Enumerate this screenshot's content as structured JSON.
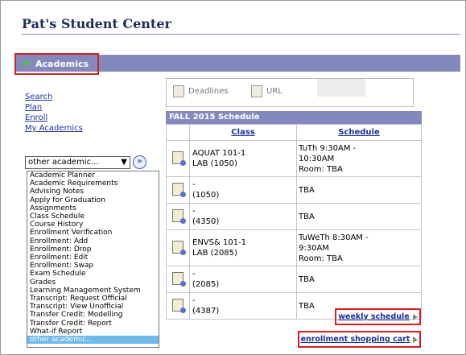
{
  "page_title": "Pat's Student Center",
  "section": {
    "label": "Academics"
  },
  "links": [
    "Search",
    "Plan",
    "Enroll",
    "My Academics"
  ],
  "dropdown": {
    "selected": "other academic...",
    "go_icon": "double-chevron-right-icon"
  },
  "listbox_items": [
    "Academic Planner",
    "Academic Requirements",
    "Advising Notes",
    "Apply for Graduation",
    "Assignments",
    "Class Schedule",
    "Course History",
    "Enrollment Verification",
    "Enrollment: Add",
    "Enrollment: Drop",
    "Enrollment: Edit",
    "Enrollment: Swap",
    "Exam Schedule",
    "Grades",
    "Learning Management System",
    "Transcript: Request Official",
    "Transcript: View Unofficial",
    "Transfer Credit: Modelling",
    "Transfer Credit: Report",
    "What-if Report",
    "other academic..."
  ],
  "listbox_selected": "other academic...",
  "deadlines": {
    "deadlines_label": "Deadlines",
    "url_label": "URL"
  },
  "schedule": {
    "header": "FALL 2015 Schedule",
    "col_class": "Class",
    "col_schedule": "Schedule",
    "rows": [
      {
        "class_line1": "AQUAT 101-1",
        "class_line2": "LAB (1050)",
        "sch1": "TuTh 9:30AM -",
        "sch2": "10:30AM",
        "sch3": "Room:  TBA"
      },
      {
        "class_line1": "-",
        "class_line2": "(1050)",
        "sch1": "TBA",
        "sch2": "",
        "sch3": ""
      },
      {
        "class_line1": "-",
        "class_line2": "(4350)",
        "sch1": "TBA",
        "sch2": "",
        "sch3": ""
      },
      {
        "class_line1": "ENVS& 101-1",
        "class_line2": "LAB (2085)",
        "sch1": "TuWeTh 8:30AM -",
        "sch2": "9:30AM",
        "sch3": "Room:  TBA"
      },
      {
        "class_line1": "-",
        "class_line2": "(2085)",
        "sch1": "TBA",
        "sch2": "",
        "sch3": ""
      },
      {
        "class_line1": "-",
        "class_line2": "(4387)",
        "sch1": "TBA",
        "sch2": "",
        "sch3": ""
      }
    ]
  },
  "buttons": {
    "weekly": "weekly schedule",
    "cart": "enrollment shopping cart"
  },
  "colors": {
    "bar": "#8489bd",
    "highlight": "#d62020",
    "link": "#1d2f9c"
  }
}
